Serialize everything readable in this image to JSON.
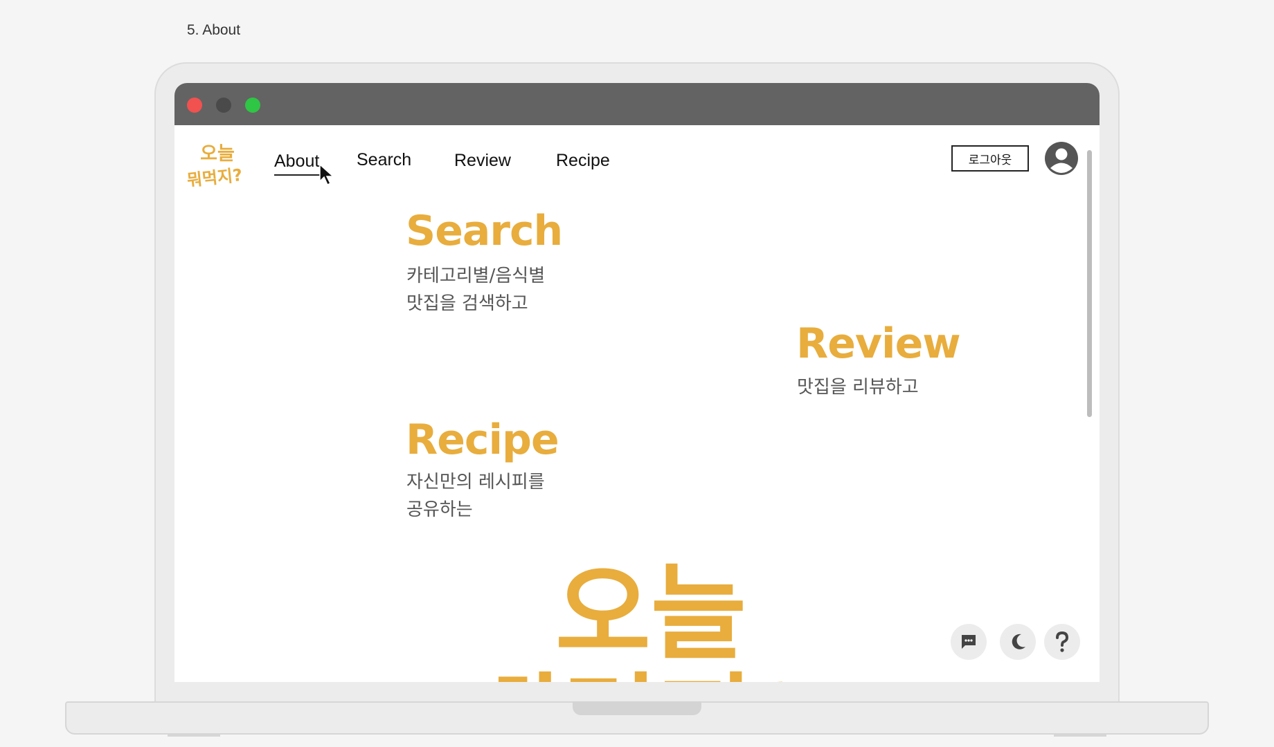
{
  "slide_label": "5. About",
  "logo": {
    "line1": "오늘",
    "line2": "뭐먹지?"
  },
  "nav": {
    "items": [
      {
        "label": "About",
        "active": true
      },
      {
        "label": "Search",
        "active": false
      },
      {
        "label": "Review",
        "active": false
      },
      {
        "label": "Recipe",
        "active": false
      }
    ]
  },
  "header": {
    "logout_label": "로그아웃"
  },
  "sections": {
    "search": {
      "title": "Search",
      "desc_line1": "카테고리별/음식별",
      "desc_line2": "맛집을 검색하고"
    },
    "review": {
      "title": "Review",
      "desc_line1": "맛집을 리뷰하고"
    },
    "recipe": {
      "title": "Recipe",
      "desc_line1": "자신만의 레시피를",
      "desc_line2": "공유하는"
    }
  },
  "floating_buttons": [
    "chat-icon",
    "moon-icon",
    "help-icon"
  ],
  "colors": {
    "accent": "#e8ad3d",
    "titlebar": "#636363",
    "close_dot": "#f1514f",
    "min_dot": "#4a4a4a",
    "max_dot": "#2fc545"
  }
}
